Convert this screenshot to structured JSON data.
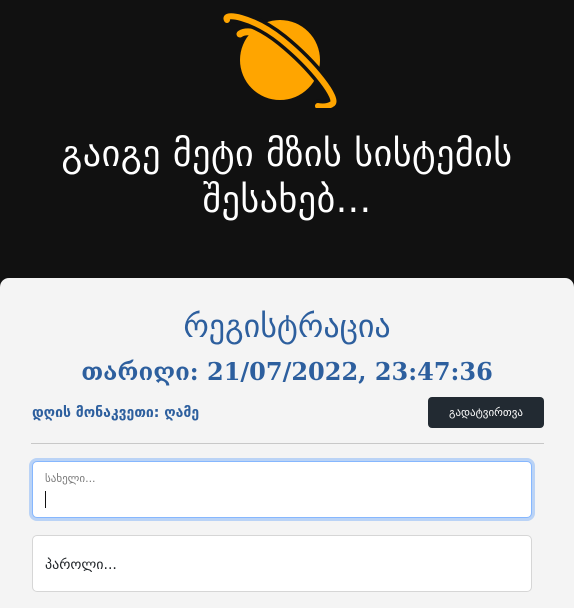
{
  "hero": {
    "title": "გაიგე მეტი მზის სისტემის შესახებ...",
    "icon": "planet-icon",
    "planet_color": "#ffa500"
  },
  "card": {
    "title": "რეგისტრაცია",
    "date_label": "თარიღი: 21/07/2022, 23:47:36",
    "time_of_day": "დღის მონაკვეთი: ღამე",
    "reload_label": "გადატვირთვა"
  },
  "form": {
    "name_placeholder": "სახელი...",
    "password_placeholder": "პაროლი..."
  },
  "colors": {
    "accent": "#2d5f9e",
    "button_bg": "#222a32",
    "hero_bg": "#111111",
    "card_bg": "#f4f4f4"
  }
}
